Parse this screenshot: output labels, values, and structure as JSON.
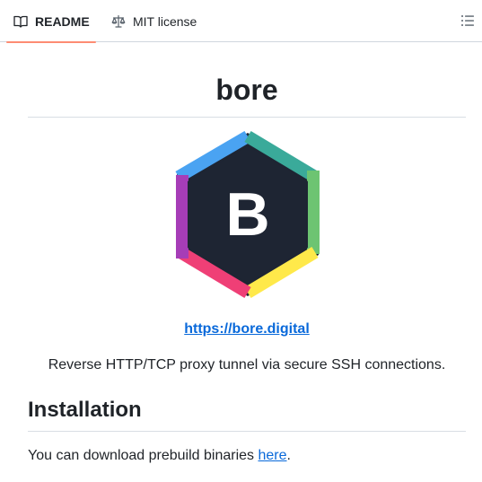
{
  "tabs": [
    {
      "label": "README",
      "icon": "book-icon",
      "active": true
    },
    {
      "label": "MIT license",
      "icon": "scale-icon",
      "active": false
    }
  ],
  "outline_icon": "list-unordered-icon",
  "readme": {
    "title": "bore",
    "logo_letter": "B",
    "link_text": "https://bore.digital",
    "description": "Reverse HTTP/TCP proxy tunnel via secure SSH connections.",
    "installation_heading": "Installation",
    "install_text_before": "You can download prebuild binaries ",
    "install_link_text": "here",
    "install_text_after": "."
  },
  "colors": {
    "active_tab_underline": "#fd8c73",
    "link": "#0969da",
    "logo_background": "#1e2533",
    "logo_segments": [
      "#4aa3f2",
      "#3aaa9a",
      "#6dc472",
      "#ffe94a",
      "#ef3f76",
      "#a63db7"
    ]
  }
}
